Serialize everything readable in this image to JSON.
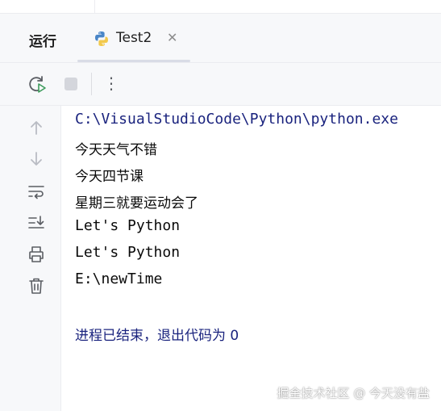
{
  "panel": {
    "run_label": "运行"
  },
  "tab": {
    "title": "Test2",
    "close_glyph": "✕"
  },
  "toolbar": {
    "more_glyph": "⋮"
  },
  "console": {
    "lines": [
      "C:\\VisualStudioCode\\Python\\python.exe",
      "今天天气不错",
      "今天四节课",
      "星期三就要运动会了",
      "Let's Python",
      "Let's Python",
      "E:\\newTime"
    ],
    "exit_message": "进程已结束，退出代码为 0"
  },
  "watermark": {
    "text": "掘金技术社区 @ 今天没有盐"
  },
  "colors": {
    "path_text": "#1a237e",
    "output_text": "#0a0a0a",
    "panel_bg": "#f7f8fa",
    "rerun_green": "#3d9c5c"
  }
}
